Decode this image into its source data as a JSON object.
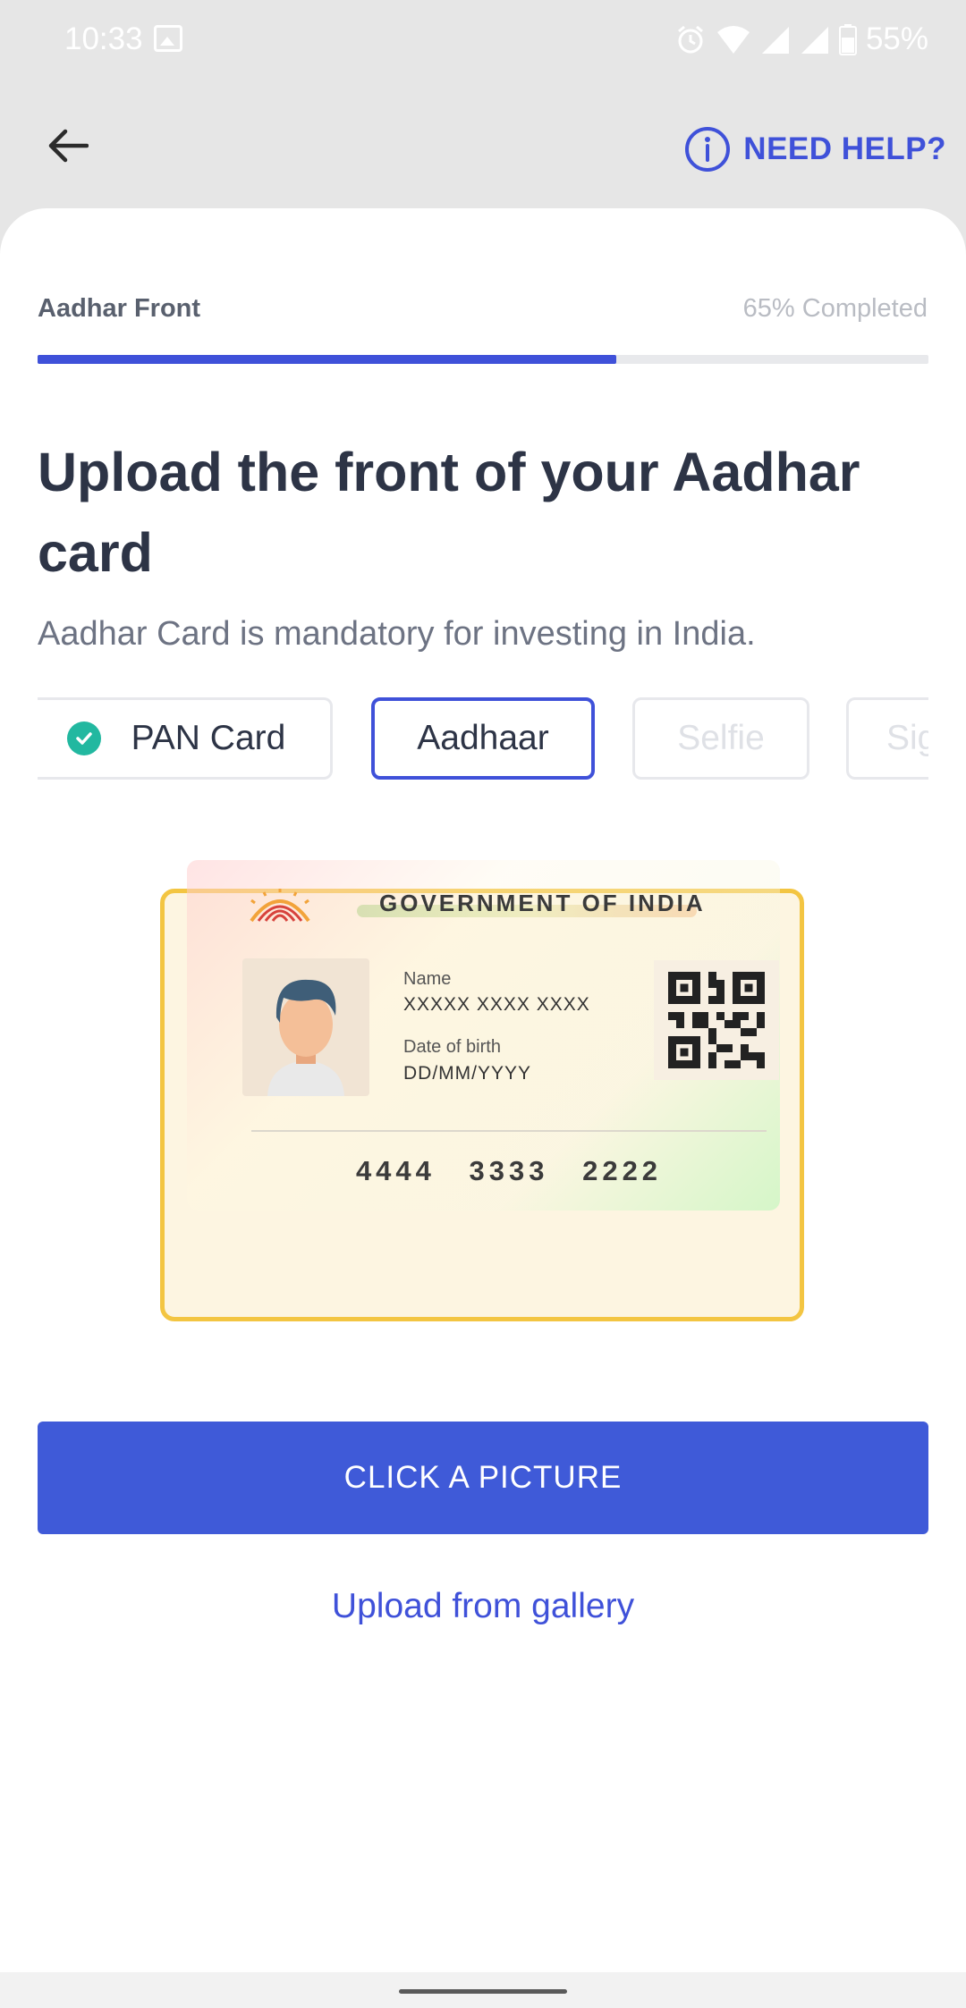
{
  "status_bar": {
    "time": "10:33",
    "battery": "55%",
    "icons": [
      "gallery-icon",
      "alarm-icon",
      "wifi-icon",
      "signal-icon",
      "signal-icon",
      "battery-icon"
    ]
  },
  "header": {
    "back_icon": "arrow-left-icon",
    "help_icon": "info-icon",
    "help_label": "NEED HELP?"
  },
  "progress": {
    "step_name": "Aadhar Front",
    "status_text": "65% Completed",
    "fraction": 0.65
  },
  "page": {
    "title": "Upload the front of your Aadhar card",
    "subtitle": "Aadhar Card is mandatory for investing in India."
  },
  "doc_tabs": [
    {
      "label": "PAN Card",
      "state": "completed"
    },
    {
      "label": "Aadhaar",
      "state": "active"
    },
    {
      "label": "Selfie",
      "state": "disabled"
    },
    {
      "label": "Sig",
      "state": "disabled"
    }
  ],
  "card": {
    "government_title": "GOVERNMENT OF INDIA",
    "name_label": "Name",
    "name_value": "XXXXX XXXX XXXX",
    "dob_label": "Date of birth",
    "dob_value": "DD/MM/YYYY",
    "number": "4444 3333 2222"
  },
  "actions": {
    "primary_label": "CLICK A PICTURE",
    "gallery_label": "Upload from gallery"
  },
  "colors": {
    "accent": "#3f51d9",
    "button": "#3f5ad8",
    "success": "#22b8a0",
    "card_border": "#f3c542"
  }
}
